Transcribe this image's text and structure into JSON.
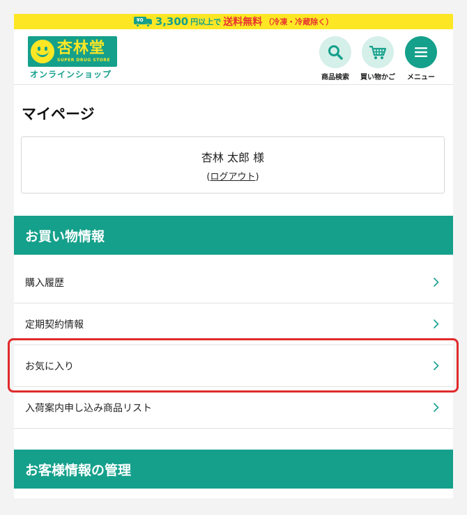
{
  "banner": {
    "truck_text": "¥0",
    "amount": "3,300",
    "unit_text": "円以上で",
    "free_text": "送料無料",
    "note": "（冷凍・冷蔵除く）"
  },
  "header": {
    "logo_main": "杏林堂",
    "logo_sub": "SUPER DRUG STORE",
    "shop_label": "オンラインショップ",
    "search_label": "商品検索",
    "cart_label": "買い物かご",
    "menu_label": "メニュー"
  },
  "main": {
    "title": "マイページ",
    "user_name": "杏林 太郎 様",
    "logout_open": "(",
    "logout_label": "ログアウト",
    "logout_close": ")"
  },
  "shopping_section": {
    "heading": "お買い物情報",
    "items": [
      {
        "label": "購入履歴"
      },
      {
        "label": "定期契約情報"
      },
      {
        "label": "お気に入り"
      },
      {
        "label": "入荷案内申し込み商品リスト"
      }
    ]
  },
  "customer_section": {
    "heading": "お客様情報の管理"
  },
  "colors": {
    "brand_green": "#15a08b",
    "brand_yellow": "#fde725",
    "accent_red": "#e8332f",
    "highlight_red": "#e02a2a"
  },
  "icons": [
    "truck-icon",
    "smile-logo-icon",
    "search-icon",
    "cart-icon",
    "menu-icon",
    "chevron-right-icon"
  ]
}
